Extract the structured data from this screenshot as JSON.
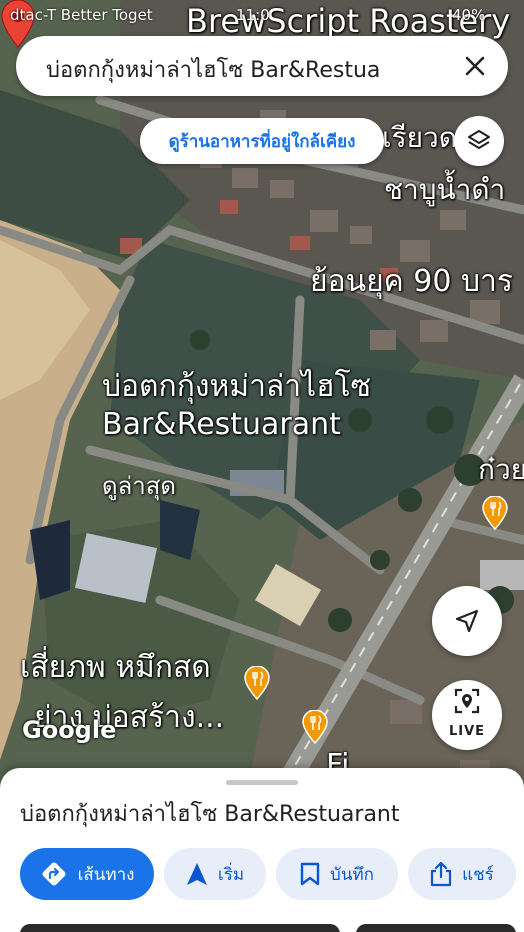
{
  "status_bar": {
    "carrier": "dtac-T Better Toget",
    "time": "11:0",
    "battery": "40%"
  },
  "search": {
    "query": "บ่อตกกุ้งหม่าล่าไฮโซ Bar&Restua"
  },
  "nearby_chip": {
    "label": "ดูร้านอาหารที่อยู่ใกล้เคียง"
  },
  "map": {
    "labels": {
      "brewscript": "BrewScript Roastery",
      "riaw": "เรียวด",
      "shabu": "ชาบูน้ำดำ",
      "yon": "ย้อนยุค 90 บาร",
      "goi": "ก๋วย",
      "seafood_1": "เสี่ยภพ หมึกสด",
      "seafood_2": "ย่าง บ่อสร้าง...",
      "fi": "Fi"
    },
    "place_label_line1": "บ่อตกกุ้งหม่าล่าไฮโซ",
    "place_label_line2": "Bar&Restuarant",
    "place_latest": "ดูล่าสุด",
    "google_logo": "Google"
  },
  "live_button": {
    "label": "LIVE"
  },
  "sheet": {
    "title": "บ่อตกกุ้งหม่าล่าไฮโซ Bar&Restuarant",
    "actions": {
      "directions": "เส้นทาง",
      "start": "เริ่ม",
      "save": "บันทึก",
      "share": "แชร์"
    }
  },
  "colors": {
    "accent": "#1a73e8",
    "pin": "#ea4335",
    "food_marker": "#f29900",
    "chip_bg": "#e8eef9"
  },
  "icons": {
    "close": "close-icon",
    "layers": "layers-icon",
    "locate": "navigation-arrow-icon",
    "live": "live-view-icon",
    "directions": "directions-icon",
    "start": "navigation-start-icon",
    "save": "bookmark-icon",
    "share": "share-icon"
  }
}
